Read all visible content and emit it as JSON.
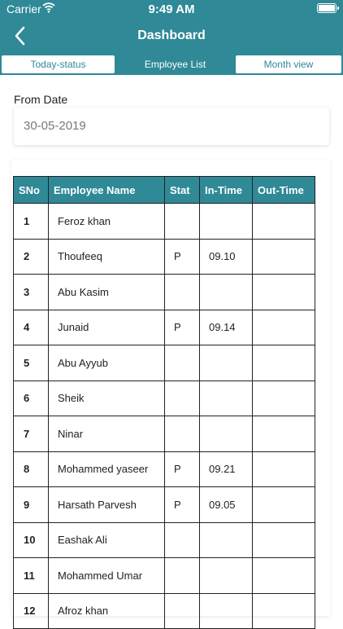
{
  "status_bar": {
    "carrier": "Carrier",
    "time": "9:49 AM"
  },
  "nav": {
    "title": "Dashboard",
    "back_icon": "chevron-left-icon"
  },
  "tabs": [
    {
      "label": "Today-status",
      "active": false
    },
    {
      "label": "Employee List",
      "active": true
    },
    {
      "label": "Month view",
      "active": false
    }
  ],
  "form": {
    "from_label": "From Date",
    "from_value": "30-05-2019"
  },
  "table": {
    "headers": [
      "SNo",
      "Employee Name",
      "Stat",
      "In-Time",
      "Out-Time"
    ],
    "rows": [
      {
        "sno": "1",
        "name": "Feroz khan",
        "stat": "",
        "in": "",
        "out": ""
      },
      {
        "sno": "2",
        "name": "Thoufeeq",
        "stat": "P",
        "in": "09.10",
        "out": ""
      },
      {
        "sno": "3",
        "name": "Abu Kasim",
        "stat": "",
        "in": "",
        "out": ""
      },
      {
        "sno": "4",
        "name": "Junaid",
        "stat": "P",
        "in": "09.14",
        "out": ""
      },
      {
        "sno": "5",
        "name": "Abu Ayyub",
        "stat": "",
        "in": "",
        "out": ""
      },
      {
        "sno": "6",
        "name": "Sheik",
        "stat": "",
        "in": "",
        "out": ""
      },
      {
        "sno": "7",
        "name": "Ninar",
        "stat": "",
        "in": "",
        "out": ""
      },
      {
        "sno": "8",
        "name": "Mohammed yaseer",
        "stat": "P",
        "in": "09.21",
        "out": ""
      },
      {
        "sno": "9",
        "name": "Harsath Parvesh",
        "stat": "P",
        "in": "09.05",
        "out": ""
      },
      {
        "sno": "10",
        "name": "Eashak Ali",
        "stat": "",
        "in": "",
        "out": ""
      },
      {
        "sno": "11",
        "name": "Mohammed Umar",
        "stat": "",
        "in": "",
        "out": ""
      },
      {
        "sno": "12",
        "name": "Afroz khan",
        "stat": "",
        "in": "",
        "out": ""
      }
    ]
  },
  "colors": {
    "primary": "#2f8997",
    "text": "#222222",
    "muted": "#777777"
  }
}
